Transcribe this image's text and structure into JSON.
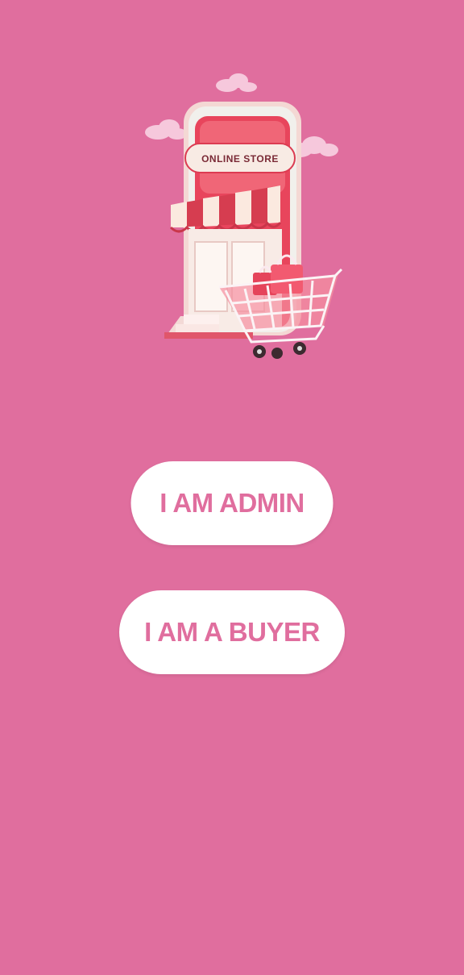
{
  "colors": {
    "background": "#e06e9e",
    "button_background": "#ffffff",
    "button_text": "#e06e9e"
  },
  "illustration": {
    "icon": "online-store-with-shopping-cart",
    "sign_text": "ONLINE STORE"
  },
  "buttons": {
    "admin_label": "I AM ADMIN",
    "buyer_label": "I AM A BUYER"
  }
}
